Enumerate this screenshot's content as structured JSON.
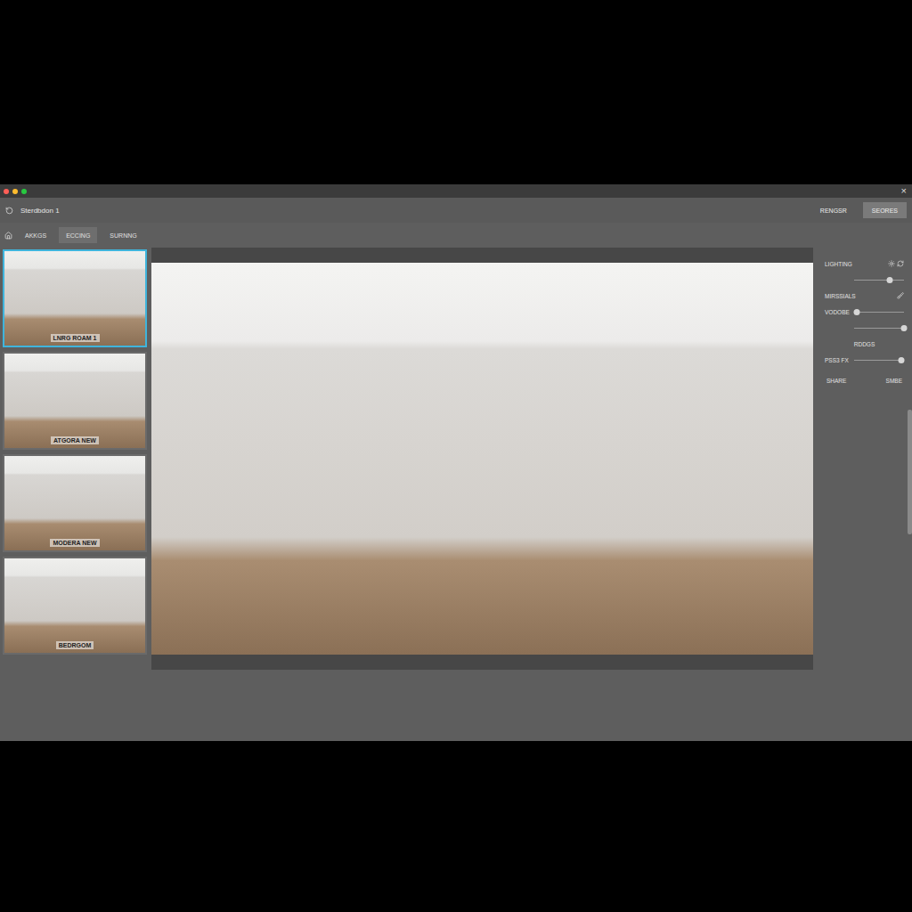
{
  "window": {
    "title": "Sterdbdon 1",
    "close": "×"
  },
  "header_buttons": [
    {
      "label": "RENGSR",
      "selected": false
    },
    {
      "label": "SEORES",
      "selected": true
    }
  ],
  "tabs": [
    {
      "label": "AKKGS",
      "selected": false
    },
    {
      "label": "ECCING",
      "selected": true
    },
    {
      "label": "SURNNG",
      "selected": false
    }
  ],
  "thumbnails": [
    {
      "label": "LNRG ROAM 1",
      "selected": true
    },
    {
      "label": "ATGORA NEW",
      "selected": false
    },
    {
      "label": "MODERA NEW",
      "selected": false
    },
    {
      "label": "BEDRGOM",
      "selected": false
    }
  ],
  "panel": {
    "rows": [
      {
        "kind": "heading",
        "label": "LIGHTING",
        "icon": "lighting"
      },
      {
        "kind": "slider",
        "level": 0.72
      },
      {
        "kind": "heading",
        "label": "MIRSSIALS",
        "icon": "materials"
      },
      {
        "kind": "slider",
        "label": "VODOBE",
        "level": 0.05
      },
      {
        "kind": "slider",
        "level": 1
      },
      {
        "kind": "caption",
        "label": "RDDGS"
      },
      {
        "kind": "slider",
        "label": "PSS3 FX",
        "level": 0.95
      }
    ],
    "buttons": [
      "SHARE",
      "SMBE"
    ]
  }
}
